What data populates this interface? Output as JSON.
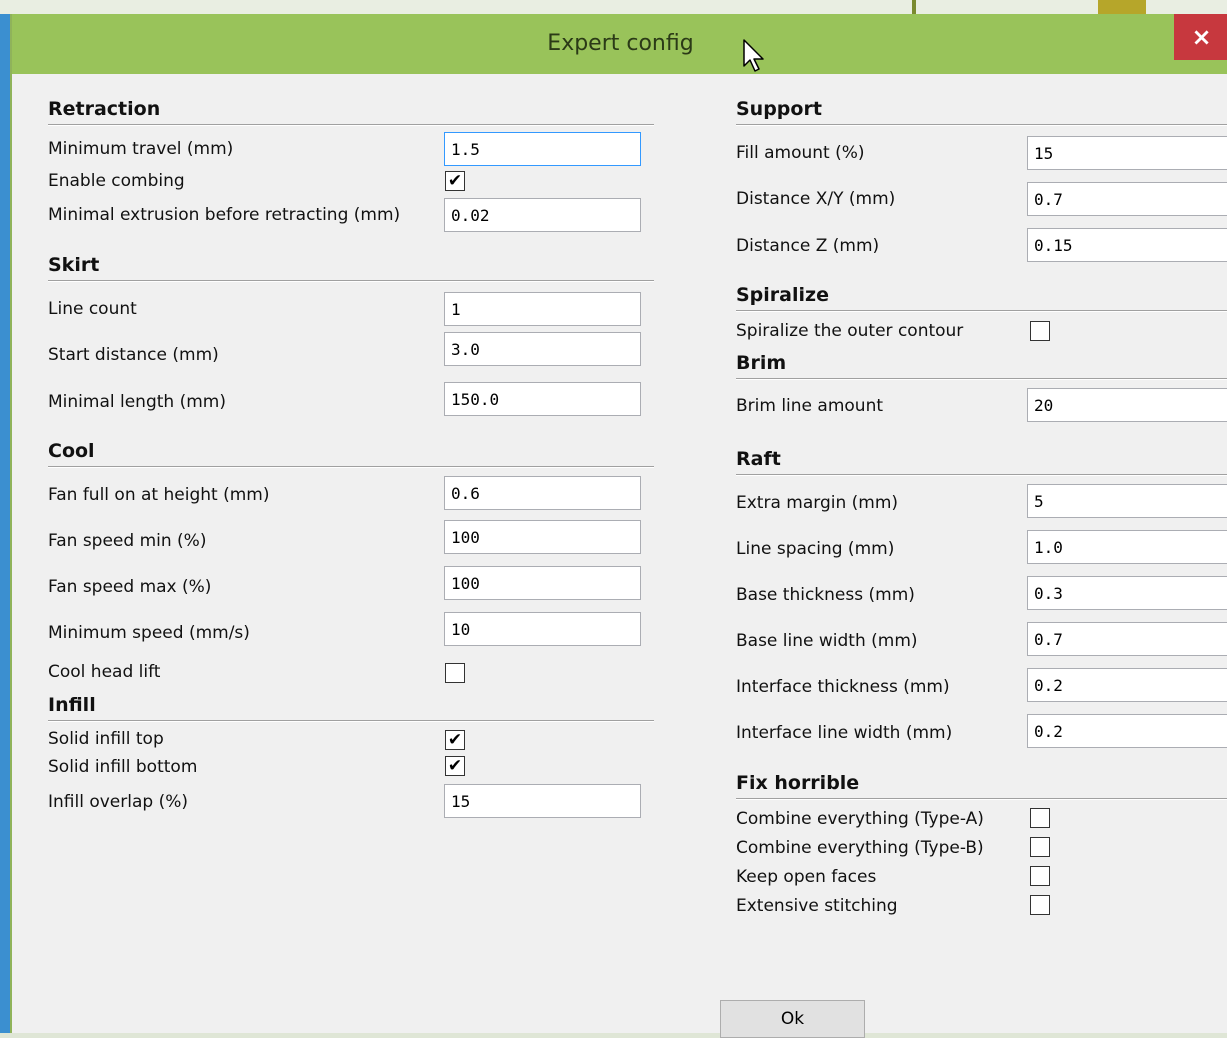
{
  "window": {
    "title": "Expert config",
    "close_glyph": "×"
  },
  "left": {
    "retraction": {
      "title": "Retraction",
      "minimum_travel": {
        "label": "Minimum travel (mm)",
        "value": "1.5"
      },
      "enable_combing": {
        "label": "Enable combing",
        "checked": true
      },
      "minimal_extrusion": {
        "label": "Minimal extrusion before retracting (mm)",
        "value": "0.02"
      }
    },
    "skirt": {
      "title": "Skirt",
      "line_count": {
        "label": "Line count",
        "value": "1"
      },
      "start_distance": {
        "label": "Start distance (mm)",
        "value": "3.0"
      },
      "minimal_length": {
        "label": "Minimal length (mm)",
        "value": "150.0"
      }
    },
    "cool": {
      "title": "Cool",
      "fan_full_on": {
        "label": "Fan full on at height (mm)",
        "value": "0.6"
      },
      "fan_speed_min": {
        "label": "Fan speed min (%)",
        "value": "100"
      },
      "fan_speed_max": {
        "label": "Fan speed max (%)",
        "value": "100"
      },
      "minimum_speed": {
        "label": "Minimum speed (mm/s)",
        "value": "10"
      },
      "cool_head_lift": {
        "label": "Cool head lift",
        "checked": false
      }
    },
    "infill": {
      "title": "Infill",
      "solid_top": {
        "label": "Solid infill top",
        "checked": true
      },
      "solid_bottom": {
        "label": "Solid infill bottom",
        "checked": true
      },
      "overlap": {
        "label": "Infill overlap (%)",
        "value": "15"
      }
    }
  },
  "right": {
    "support": {
      "title": "Support",
      "fill_amount": {
        "label": "Fill amount (%)",
        "value": "15"
      },
      "distance_xy": {
        "label": "Distance X/Y (mm)",
        "value": "0.7"
      },
      "distance_z": {
        "label": "Distance Z (mm)",
        "value": "0.15"
      }
    },
    "spiralize": {
      "title": "Spiralize",
      "outer_contour": {
        "label": "Spiralize the outer contour",
        "checked": false
      }
    },
    "brim": {
      "title": "Brim",
      "line_amount": {
        "label": "Brim line amount",
        "value": "20"
      }
    },
    "raft": {
      "title": "Raft",
      "extra_margin": {
        "label": "Extra margin (mm)",
        "value": "5"
      },
      "line_spacing": {
        "label": "Line spacing (mm)",
        "value": "1.0"
      },
      "base_thickness": {
        "label": "Base thickness (mm)",
        "value": "0.3"
      },
      "base_line_width": {
        "label": "Base line width (mm)",
        "value": "0.7"
      },
      "interface_thickness": {
        "label": "Interface thickness (mm)",
        "value": "0.2"
      },
      "interface_line_width": {
        "label": "Interface line width (mm)",
        "value": "0.2"
      }
    },
    "fix_horrible": {
      "title": "Fix horrible",
      "combine_a": {
        "label": "Combine everything (Type-A)",
        "checked": false
      },
      "combine_b": {
        "label": "Combine everything (Type-B)",
        "checked": false
      },
      "keep_open_faces": {
        "label": "Keep open faces",
        "checked": false
      },
      "extensive_stitching": {
        "label": "Extensive stitching",
        "checked": false
      }
    }
  },
  "ok_label": "Ok",
  "check_glyph": "✔"
}
